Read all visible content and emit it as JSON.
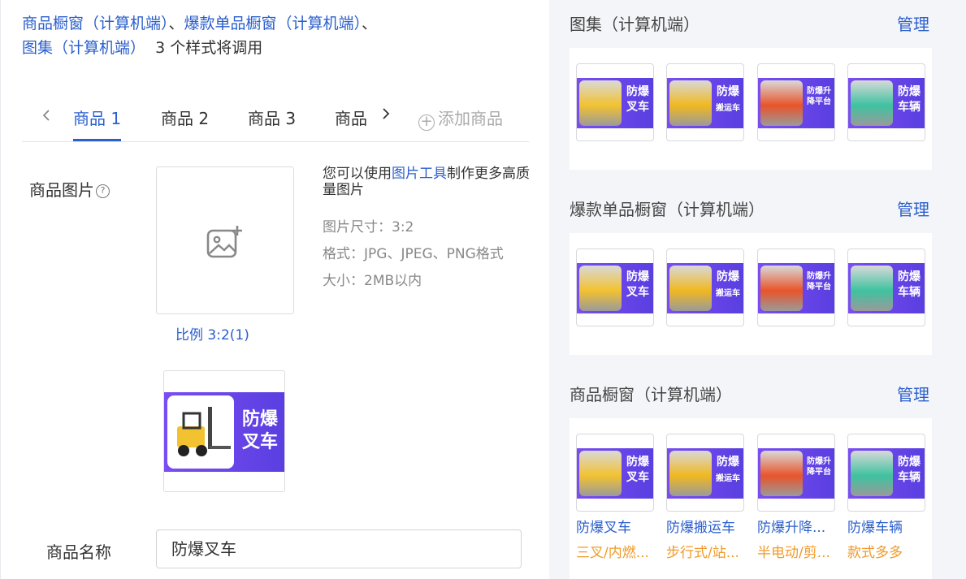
{
  "usage": {
    "link1": "商品橱窗（计算机端）",
    "sep1": "、",
    "link2": "爆款单品橱窗（计算机端）",
    "sep2": "、",
    "link3": "图集（计算机端）",
    "suffix": "3 个样式将调用"
  },
  "tabs": {
    "items": [
      "商品 1",
      "商品 2",
      "商品 3",
      "商品"
    ],
    "add_label": "添加商品",
    "prev_icon": "chevron-left-icon",
    "next_icon": "chevron-right-icon"
  },
  "form": {
    "image_label": "商品图片",
    "help_glyph": "?",
    "ratio_link": "比例 3:2(1)",
    "tip_prefix": "您可以使用",
    "tip_link": "图片工具",
    "tip_suffix": "制作更多高质量图片",
    "spec_size": "图片尺寸：3:2",
    "spec_format": "格式：JPG、JPEG、PNG格式",
    "spec_filesize": "大小：2MB以内",
    "preview_line1": "防爆",
    "preview_line2": "叉车",
    "name_label": "商品名称",
    "name_value": "防爆叉车"
  },
  "sections": [
    {
      "title": "图集（计算机端）",
      "manage": "管理"
    },
    {
      "title": "爆款单品橱窗（计算机端）",
      "manage": "管理"
    },
    {
      "title": "商品橱窗（计算机端）",
      "manage": "管理"
    }
  ],
  "products": [
    {
      "line1": "防爆",
      "line2": "叉车",
      "name": "防爆叉车",
      "desc": "三叉/内燃...",
      "photo_color": "#f2c230"
    },
    {
      "line1": "防爆",
      "line2": "搬运车",
      "name": "防爆搬运车",
      "desc": "步行式/站...",
      "photo_color": "#f0b820"
    },
    {
      "line1": "防爆升",
      "line2": "降平台",
      "name": "防爆升降...",
      "desc": "半电动/剪...",
      "photo_color": "#e8542a"
    },
    {
      "line1": "防爆",
      "line2": "车辆",
      "name": "防爆车辆",
      "desc": "款式多多",
      "photo_color": "#3fc2a0"
    }
  ],
  "colors": {
    "accent": "#2b5fcc",
    "banner": "#6a45ea",
    "desc": "#f19a28"
  }
}
